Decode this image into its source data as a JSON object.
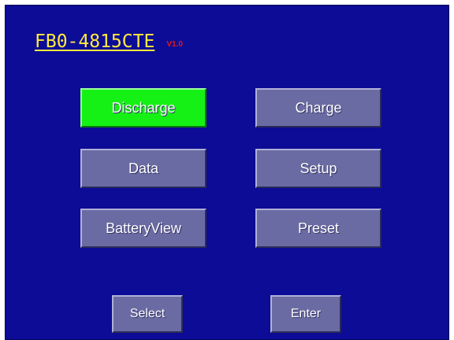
{
  "header": {
    "device_model": "FB0-4815CTE",
    "version": "V1.0"
  },
  "menu": {
    "discharge_label": "Discharge",
    "charge_label": "Charge",
    "data_label": "Data",
    "setup_label": "Setup",
    "battery_view_label": "BatteryView",
    "preset_label": "Preset",
    "selected_item": "Discharge"
  },
  "footer": {
    "select_label": "Select",
    "enter_label": "Enter"
  },
  "colors": {
    "screen_background": "#0c0c96",
    "button_face": "#6b6ba3",
    "selected_button": "#15f115",
    "title": "#ffea3c",
    "version": "#e01a1a"
  }
}
